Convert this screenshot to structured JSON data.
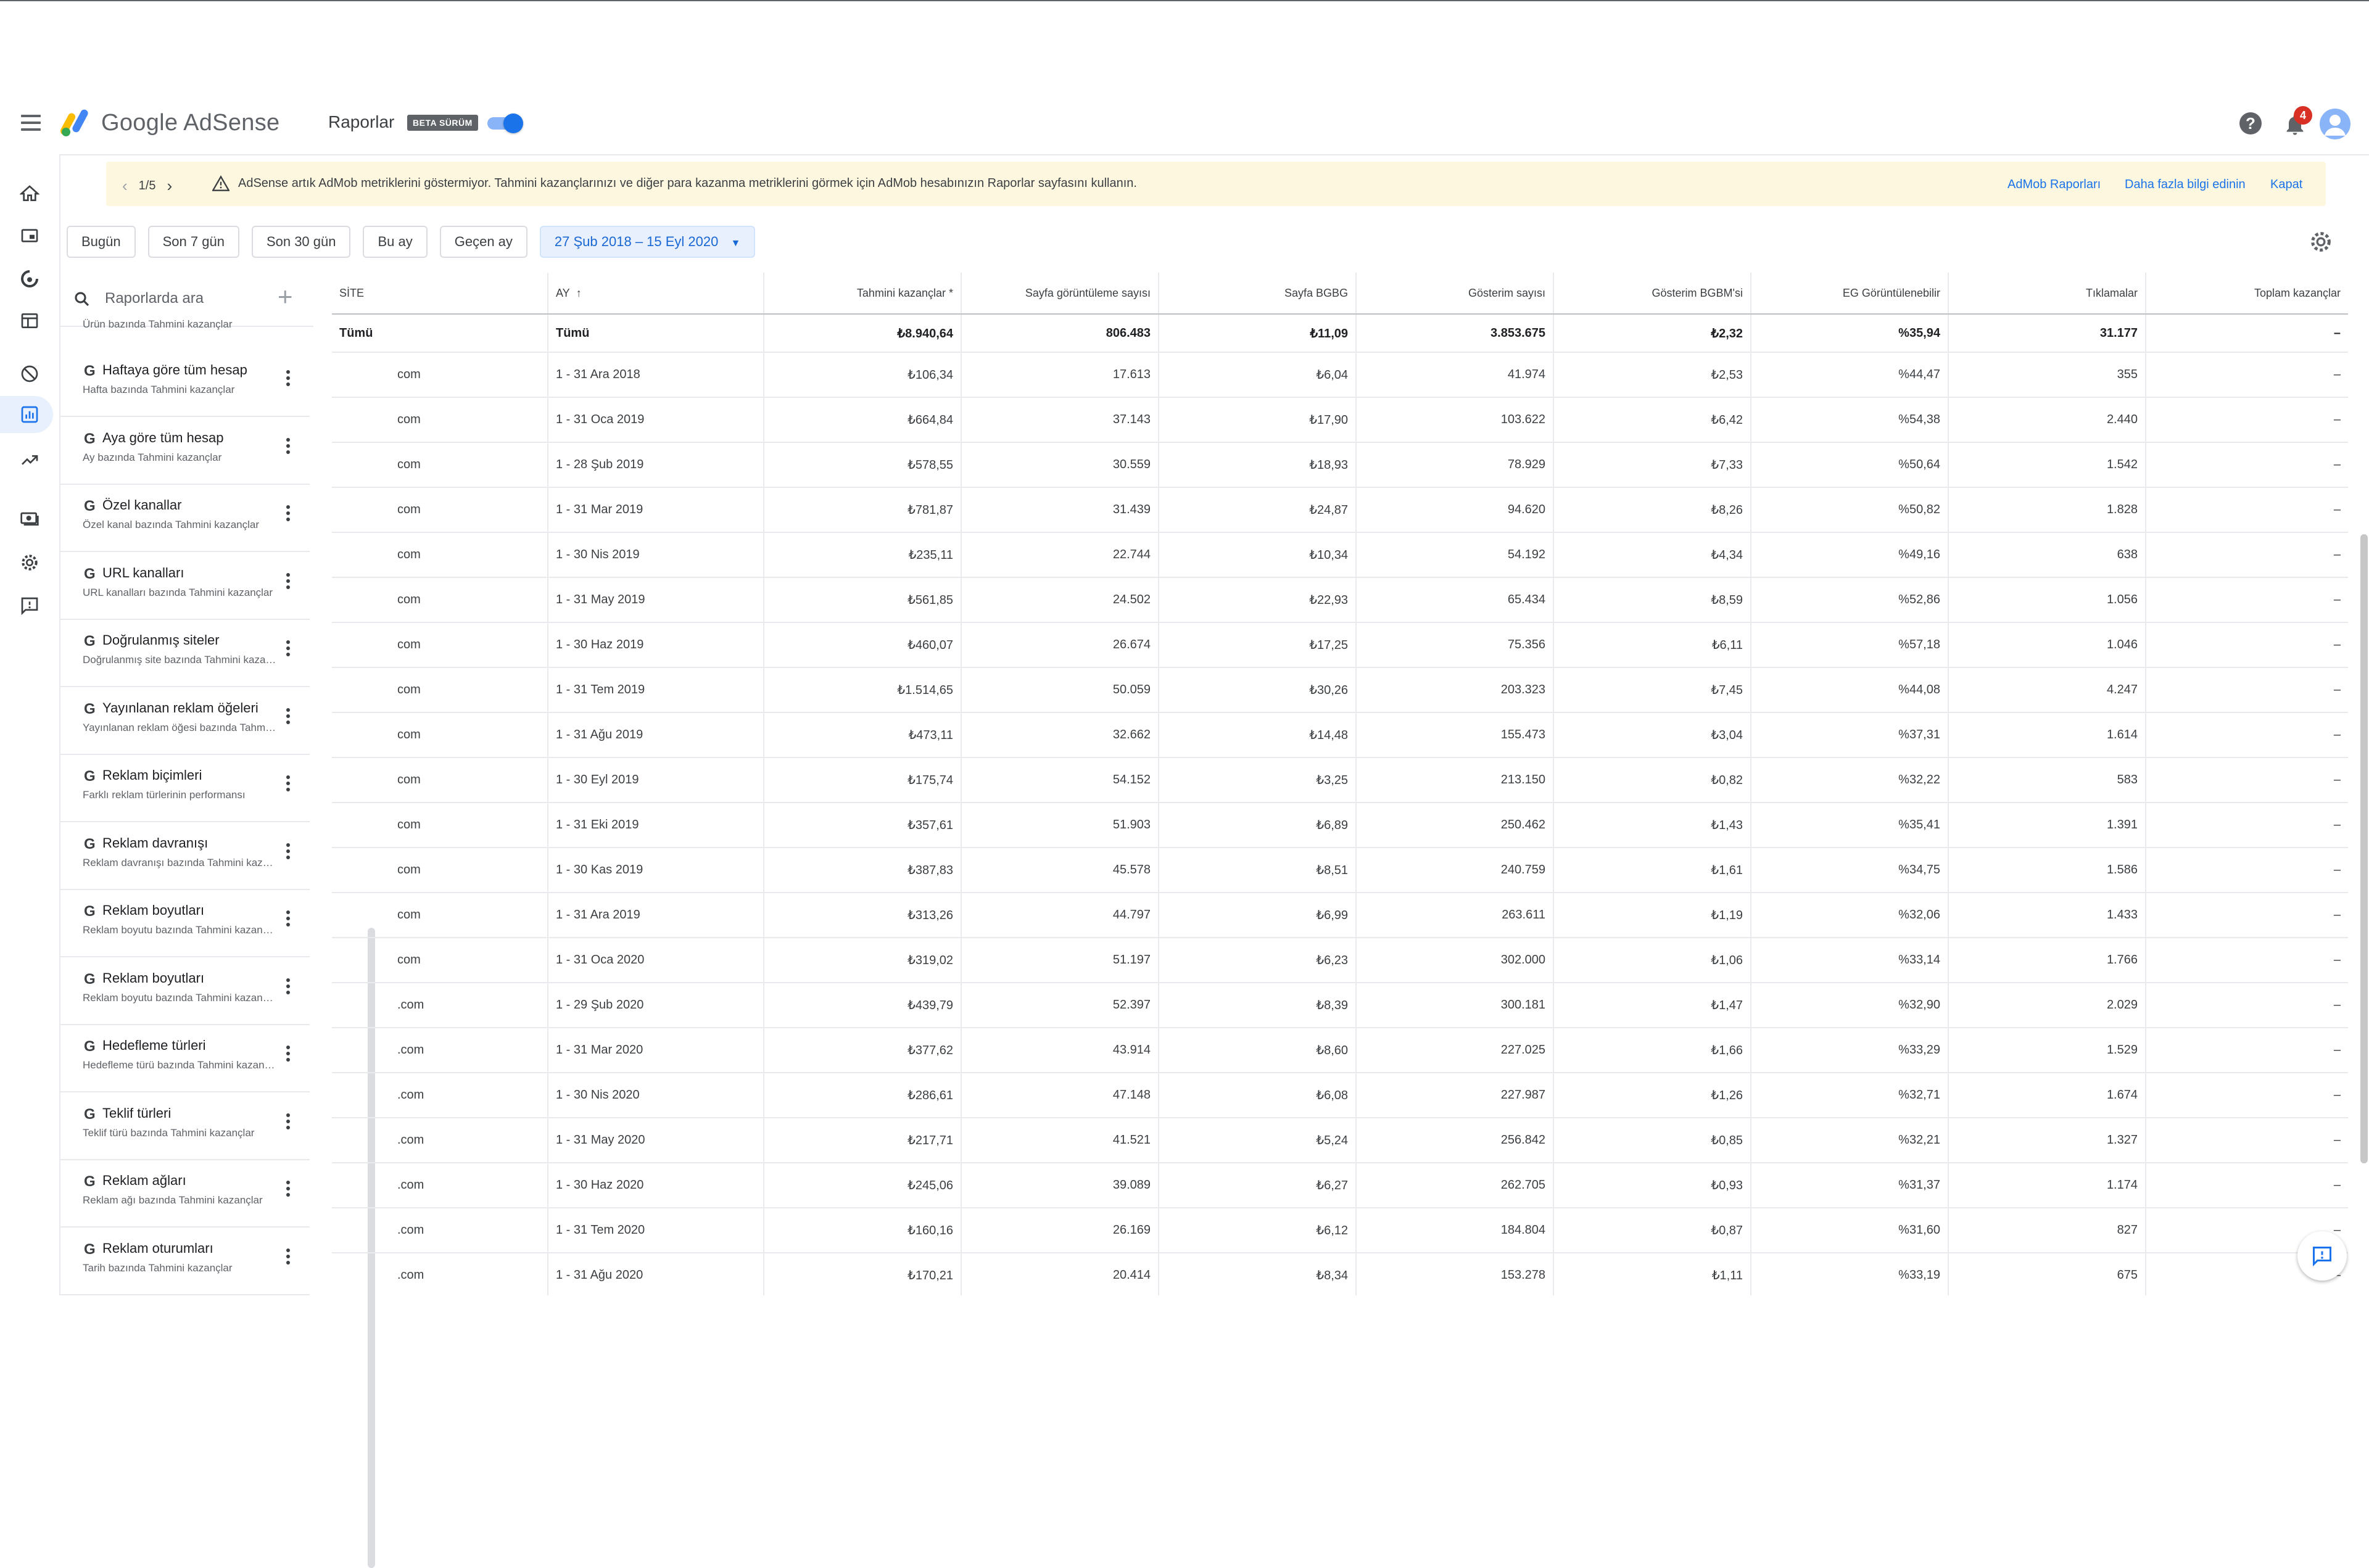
{
  "header": {
    "brand": "Google AdSense",
    "page_title": "Raporlar",
    "beta_badge": "BETA SÜRÜM",
    "notification_count": "4"
  },
  "banner": {
    "pager": "1/5",
    "message": "AdSense artık AdMob metriklerini göstermiyor. Tahmini kazançlarınızı ve diğer para kazanma metriklerini görmek için AdMob hesabınızın Raporlar sayfasını kullanın.",
    "link_admob": "AdMob Raporları",
    "link_more": "Daha fazla bilgi edinin",
    "link_close": "Kapat"
  },
  "date_ranges": {
    "today": "Bugün",
    "last7": "Son 7 gün",
    "last30": "Son 30 gün",
    "this_month": "Bu ay",
    "last_month": "Geçen ay",
    "custom": "27 Şub 2018 – 15 Eyl 2020"
  },
  "sidepanel": {
    "search_placeholder": "Raporlarda ara",
    "partial_subtitle": "Ürün bazında Tahmini kazançlar",
    "reports": [
      {
        "title": "Haftaya göre tüm hesap",
        "subtitle": "Hafta bazında Tahmini kazançlar"
      },
      {
        "title": "Aya göre tüm hesap",
        "subtitle": "Ay bazında Tahmini kazançlar"
      },
      {
        "title": "Özel kanallar",
        "subtitle": "Özel kanal bazında Tahmini kazançlar"
      },
      {
        "title": "URL kanalları",
        "subtitle": "URL kanalları bazında Tahmini kazançlar"
      },
      {
        "title": "Doğrulanmış siteler",
        "subtitle": "Doğrulanmış site bazında Tahmini kazançlar"
      },
      {
        "title": "Yayınlanan reklam öğeleri",
        "subtitle": "Yayınlanan reklam öğesi bazında Tahmini kazançlar"
      },
      {
        "title": "Reklam biçimleri",
        "subtitle": "Farklı reklam türlerinin performansı"
      },
      {
        "title": "Reklam davranışı",
        "subtitle": "Reklam davranışı bazında Tahmini kazançlar"
      },
      {
        "title": "Reklam boyutları",
        "subtitle": "Reklam boyutu bazında Tahmini kazançlar"
      },
      {
        "title": "Reklam boyutları",
        "subtitle": "Reklam boyutu bazında Tahmini kazançlar"
      },
      {
        "title": "Hedefleme türleri",
        "subtitle": "Hedefleme türü bazında Tahmini kazançlar"
      },
      {
        "title": "Teklif türleri",
        "subtitle": "Teklif türü bazında Tahmini kazançlar"
      },
      {
        "title": "Reklam ağları",
        "subtitle": "Reklam ağı bazında Tahmini kazançlar"
      },
      {
        "title": "Reklam oturumları",
        "subtitle": "Tarih bazında Tahmini kazançlar"
      }
    ]
  },
  "table": {
    "columns": [
      "SİTE",
      "AY",
      "Tahmini kazançlar *",
      "Sayfa görüntüleme sayısı",
      "Sayfa BGBG",
      "Gösterim sayısı",
      "Gösterim BGBM'si",
      "EG Görüntülenebilir",
      "Tıklamalar",
      "Toplam kazançlar"
    ],
    "total": [
      "Tümü",
      "Tümü",
      "₺8.940,64",
      "806.483",
      "₺11,09",
      "3.853.675",
      "₺2,32",
      "%35,94",
      "31.177",
      "–"
    ],
    "rows": [
      [
        "com",
        "1 - 31 Ara 2018",
        "₺106,34",
        "17.613",
        "₺6,04",
        "41.974",
        "₺2,53",
        "%44,47",
        "355",
        "–"
      ],
      [
        "com",
        "1 - 31 Oca 2019",
        "₺664,84",
        "37.143",
        "₺17,90",
        "103.622",
        "₺6,42",
        "%54,38",
        "2.440",
        "–"
      ],
      [
        "com",
        "1 - 28 Şub 2019",
        "₺578,55",
        "30.559",
        "₺18,93",
        "78.929",
        "₺7,33",
        "%50,64",
        "1.542",
        "–"
      ],
      [
        "com",
        "1 - 31 Mar 2019",
        "₺781,87",
        "31.439",
        "₺24,87",
        "94.620",
        "₺8,26",
        "%50,82",
        "1.828",
        "–"
      ],
      [
        "com",
        "1 - 30 Nis 2019",
        "₺235,11",
        "22.744",
        "₺10,34",
        "54.192",
        "₺4,34",
        "%49,16",
        "638",
        "–"
      ],
      [
        "com",
        "1 - 31 May 2019",
        "₺561,85",
        "24.502",
        "₺22,93",
        "65.434",
        "₺8,59",
        "%52,86",
        "1.056",
        "–"
      ],
      [
        "com",
        "1 - 30 Haz 2019",
        "₺460,07",
        "26.674",
        "₺17,25",
        "75.356",
        "₺6,11",
        "%57,18",
        "1.046",
        "–"
      ],
      [
        "com",
        "1 - 31 Tem 2019",
        "₺1.514,65",
        "50.059",
        "₺30,26",
        "203.323",
        "₺7,45",
        "%44,08",
        "4.247",
        "–"
      ],
      [
        "com",
        "1 - 31 Ağu 2019",
        "₺473,11",
        "32.662",
        "₺14,48",
        "155.473",
        "₺3,04",
        "%37,31",
        "1.614",
        "–"
      ],
      [
        "com",
        "1 - 30 Eyl 2019",
        "₺175,74",
        "54.152",
        "₺3,25",
        "213.150",
        "₺0,82",
        "%32,22",
        "583",
        "–"
      ],
      [
        "com",
        "1 - 31 Eki 2019",
        "₺357,61",
        "51.903",
        "₺6,89",
        "250.462",
        "₺1,43",
        "%35,41",
        "1.391",
        "–"
      ],
      [
        "com",
        "1 - 30 Kas 2019",
        "₺387,83",
        "45.578",
        "₺8,51",
        "240.759",
        "₺1,61",
        "%34,75",
        "1.586",
        "–"
      ],
      [
        "com",
        "1 - 31 Ara 2019",
        "₺313,26",
        "44.797",
        "₺6,99",
        "263.611",
        "₺1,19",
        "%32,06",
        "1.433",
        "–"
      ],
      [
        "com",
        "1 - 31 Oca 2020",
        "₺319,02",
        "51.197",
        "₺6,23",
        "302.000",
        "₺1,06",
        "%33,14",
        "1.766",
        "–"
      ],
      [
        ".com",
        "1 - 29 Şub 2020",
        "₺439,79",
        "52.397",
        "₺8,39",
        "300.181",
        "₺1,47",
        "%32,90",
        "2.029",
        "–"
      ],
      [
        ".com",
        "1 - 31 Mar 2020",
        "₺377,62",
        "43.914",
        "₺8,60",
        "227.025",
        "₺1,66",
        "%33,29",
        "1.529",
        "–"
      ],
      [
        ".com",
        "1 - 30 Nis 2020",
        "₺286,61",
        "47.148",
        "₺6,08",
        "227.987",
        "₺1,26",
        "%32,71",
        "1.674",
        "–"
      ],
      [
        ".com",
        "1 - 31 May 2020",
        "₺217,71",
        "41.521",
        "₺5,24",
        "256.842",
        "₺0,85",
        "%32,21",
        "1.327",
        "–"
      ],
      [
        ".com",
        "1 - 30 Haz 2020",
        "₺245,06",
        "39.089",
        "₺6,27",
        "262.705",
        "₺0,93",
        "%31,37",
        "1.174",
        "–"
      ],
      [
        ".com",
        "1 - 31 Tem 2020",
        "₺160,16",
        "26.169",
        "₺6,12",
        "184.804",
        "₺0,87",
        "%31,60",
        "827",
        "–"
      ],
      [
        ".com",
        "1 - 31 Ağu 2020",
        "₺170,21",
        "20.414",
        "₺8,34",
        "153.278",
        "₺1,11",
        "%33,19",
        "675",
        "–"
      ]
    ]
  },
  "colors": {
    "accent": "#1a73e8",
    "banner_bg": "#fef7e0",
    "notification_badge": "#d93025",
    "chip_active_bg": "#e8f0fe"
  },
  "icons": [
    "menu-icon",
    "adsense-logo-icon",
    "help-icon",
    "bell-icon",
    "account-icon",
    "home-icon",
    "ads-icon",
    "auto-ads-icon",
    "sites-icon",
    "block-icon",
    "reports-icon",
    "optimization-icon",
    "payments-icon",
    "settings-icon",
    "feedback-icon",
    "search-icon",
    "add-icon",
    "more-vert-icon",
    "warning-icon",
    "sort-arrow-icon",
    "dropdown-arrow-icon"
  ]
}
